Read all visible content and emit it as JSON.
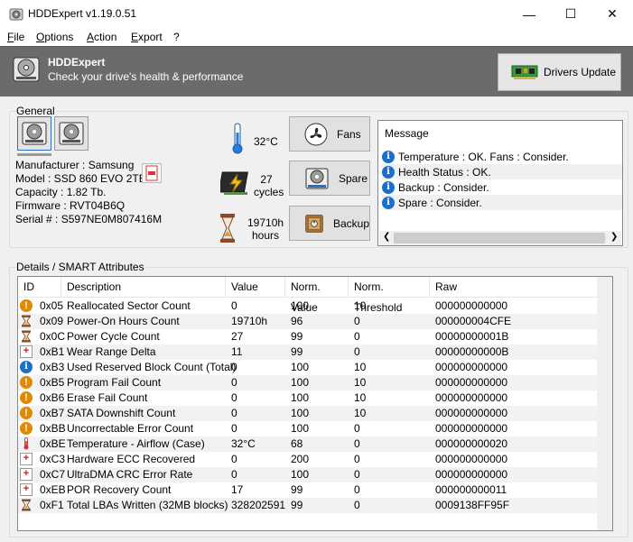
{
  "window": {
    "title": "HDDExpert v1.19.0.51",
    "minimize_glyph": "—",
    "maximize_glyph": "☐",
    "close_glyph": "✕"
  },
  "menu": [
    {
      "label": "File",
      "accel": "F"
    },
    {
      "label": "Options",
      "accel": "O"
    },
    {
      "label": "Action",
      "accel": "A"
    },
    {
      "label": "Export",
      "accel": "E"
    },
    {
      "label": "?",
      "accel": ""
    }
  ],
  "banner": {
    "title": "HDDExpert",
    "subtitle": "Check your drive's health & performance",
    "drivers_button": "Drivers Update"
  },
  "general": {
    "label": "General",
    "manufacturer": "Manufacturer : Samsung",
    "model": "Model : SSD 860 EVO 2TB",
    "capacity": "Capacity : 1.82 Tb.",
    "firmware": "Firmware : RVT04B6Q",
    "serial": "Serial # : S597NE0M807416M",
    "temperature": "32°C",
    "cycles_value": "27",
    "cycles_unit": "cycles",
    "hours_value": "19710h",
    "hours_unit": "hours",
    "fans_button": "Fans",
    "spare_button": "Spare",
    "backup_button": "Backup"
  },
  "messages": {
    "title": "Message",
    "items": [
      "Temperature : OK. Fans : Consider.",
      "Health Status : OK.",
      "Backup : Consider.",
      "Spare : Consider."
    ]
  },
  "details": {
    "label": "Details / SMART Attributes",
    "columns": [
      "ID",
      "Description",
      "Value",
      "Norm. Value",
      "Norm. Threshold",
      "Raw"
    ],
    "rows": [
      {
        "icon": "warning-icon",
        "id": "0x05",
        "desc": "Reallocated Sector Count",
        "value": "0",
        "norm": "100",
        "thresh": "10",
        "raw": "000000000000"
      },
      {
        "icon": "hourglass-icon",
        "id": "0x09",
        "desc": "Power-On Hours Count",
        "value": "19710h",
        "norm": "96",
        "thresh": "0",
        "raw": "000000004CFE"
      },
      {
        "icon": "hourglass-icon",
        "id": "0x0C",
        "desc": "Power Cycle Count",
        "value": "27",
        "norm": "99",
        "thresh": "0",
        "raw": "00000000001B"
      },
      {
        "icon": "ecc-icon",
        "id": "0xB1",
        "desc": "Wear Range Delta",
        "value": "11",
        "norm": "99",
        "thresh": "0",
        "raw": "00000000000B"
      },
      {
        "icon": "info-icon",
        "id": "0xB3",
        "desc": "Used Reserved Block Count (Total)",
        "value": "0",
        "norm": "100",
        "thresh": "10",
        "raw": "000000000000"
      },
      {
        "icon": "warning-icon",
        "id": "0xB5",
        "desc": "Program Fail Count",
        "value": "0",
        "norm": "100",
        "thresh": "10",
        "raw": "000000000000"
      },
      {
        "icon": "warning-icon",
        "id": "0xB6",
        "desc": "Erase Fail Count",
        "value": "0",
        "norm": "100",
        "thresh": "10",
        "raw": "000000000000"
      },
      {
        "icon": "warning-icon",
        "id": "0xB7",
        "desc": "SATA Downshift Count",
        "value": "0",
        "norm": "100",
        "thresh": "10",
        "raw": "000000000000"
      },
      {
        "icon": "warning-icon",
        "id": "0xBB",
        "desc": "Uncorrectable Error Count",
        "value": "0",
        "norm": "100",
        "thresh": "0",
        "raw": "000000000000"
      },
      {
        "icon": "thermometer-icon",
        "id": "0xBE",
        "desc": "Temperature - Airflow (Case)",
        "value": "32°C",
        "norm": "68",
        "thresh": "0",
        "raw": "000000000020"
      },
      {
        "icon": "ecc-icon",
        "id": "0xC3",
        "desc": "Hardware ECC Recovered",
        "value": "0",
        "norm": "200",
        "thresh": "0",
        "raw": "000000000000"
      },
      {
        "icon": "ecc-icon",
        "id": "0xC7",
        "desc": "UltraDMA CRC Error Rate",
        "value": "0",
        "norm": "100",
        "thresh": "0",
        "raw": "000000000000"
      },
      {
        "icon": "ecc-icon",
        "id": "0xEB",
        "desc": "POR Recovery Count",
        "value": "17",
        "norm": "99",
        "thresh": "0",
        "raw": "000000000011"
      },
      {
        "icon": "hourglass-icon",
        "id": "0xF1",
        "desc": "Total LBAs Written (32MB blocks)",
        "value": "328202591",
        "norm": "99",
        "thresh": "0",
        "raw": "0009138FF95F"
      }
    ]
  },
  "colors": {
    "banner_bg": "#6b6b6b",
    "info_blue": "#1a6fc9",
    "warning_orange": "#e08a00",
    "ecc_red": "#d01818"
  }
}
